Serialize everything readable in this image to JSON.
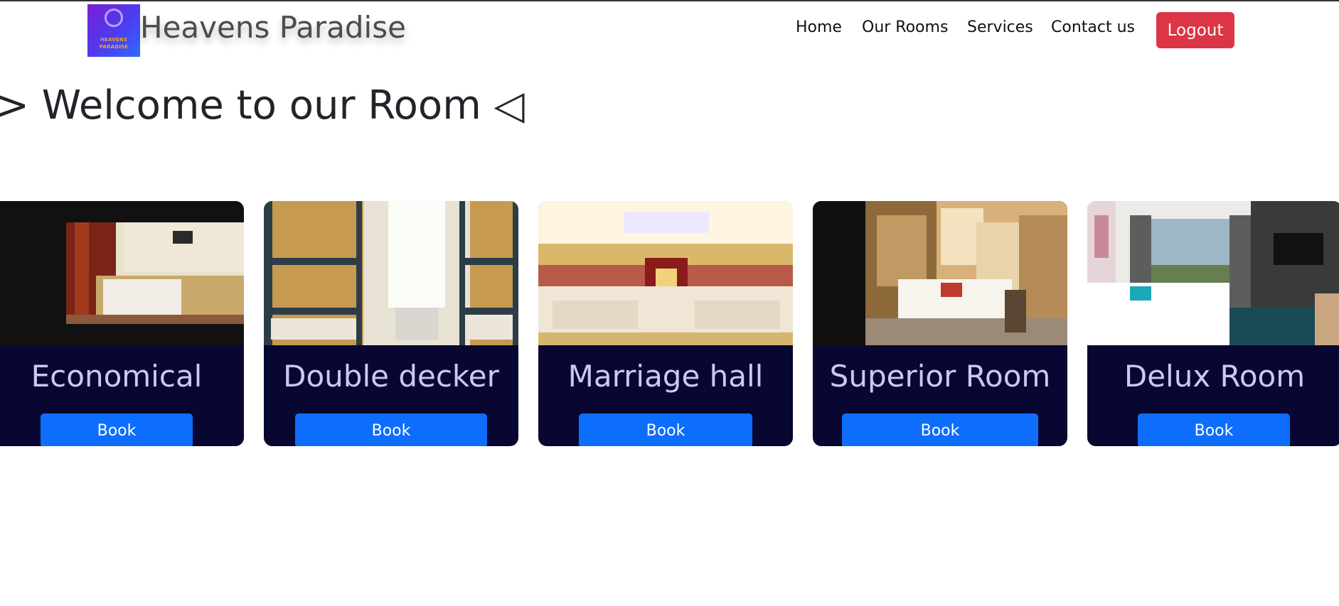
{
  "header": {
    "brand": "Heavens Paradise",
    "logo_text_line1": "HEAVENS",
    "logo_text_line2": "PARADISE"
  },
  "nav": {
    "items": [
      "Home",
      "Our Rooms",
      "Services",
      "Contact us"
    ],
    "logout_label": "Logout"
  },
  "main": {
    "heading": "> Welcome to our Room ◁"
  },
  "rooms": [
    {
      "title": "Economical",
      "button": "Book"
    },
    {
      "title": "Double decker",
      "button": "Book"
    },
    {
      "title": "Marriage hall",
      "button": "Book"
    },
    {
      "title": "Superior Room",
      "button": "Book"
    },
    {
      "title": "Delux Room",
      "button": "Book"
    }
  ],
  "colors": {
    "card_bg": "#070731",
    "card_title": "#c9c9f2",
    "book_button": "#0d6efd",
    "logout_button": "#dc3545"
  }
}
